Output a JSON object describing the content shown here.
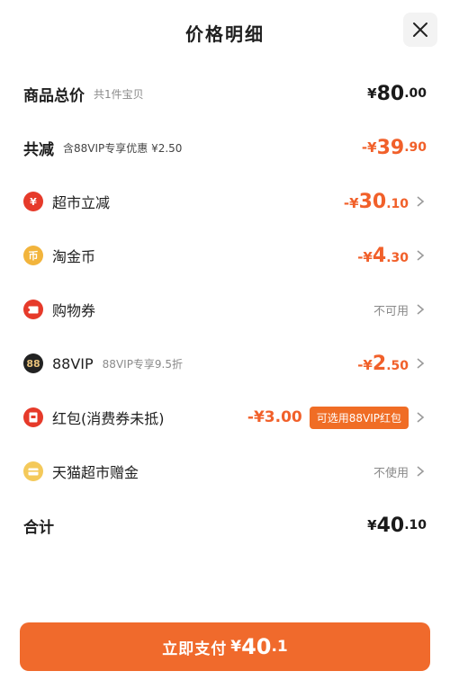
{
  "header": {
    "title": "价格明细",
    "close_icon": "close-icon"
  },
  "rows": {
    "total": {
      "label": "商品总价",
      "sub": "共1件宝贝",
      "currency": "¥",
      "int": "80",
      "dec": ".00"
    },
    "reduced": {
      "label": "共减",
      "sub": "含88VIP专享优惠 ¥2.50",
      "currency": "-¥",
      "int": "39",
      "dec": ".90"
    },
    "supermarket": {
      "label": "超市立减",
      "currency": "-¥",
      "int": "30",
      "dec": ".10",
      "icon": "yuan-badge-icon"
    },
    "taojinbi": {
      "label": "淘金币",
      "currency": "-¥",
      "int": "4",
      "dec": ".30",
      "icon": "coin-icon",
      "icon_text": "币"
    },
    "coupon": {
      "label": "购物券",
      "status": "不可用",
      "icon": "ticket-icon"
    },
    "vip": {
      "label": "88VIP",
      "sub": "88VIP专享9.5折",
      "currency": "-¥",
      "int": "2",
      "dec": ".50",
      "icon": "88-badge-icon",
      "icon_text": "88"
    },
    "redpacket": {
      "label": "红包(消费券未抵)",
      "amount": "-¥3.00",
      "pill": "可选用88VIP红包",
      "icon": "red-packet-icon"
    },
    "tmall_gift": {
      "label": "天猫超市赠金",
      "status": "不使用",
      "icon": "gift-card-icon"
    },
    "sum": {
      "label": "合计",
      "currency": "¥",
      "int": "40",
      "dec": ".10"
    }
  },
  "pay_button": {
    "label": "立即支付",
    "currency": "¥",
    "int": "40",
    "dec": ".1"
  },
  "colors": {
    "accent": "#f06a2c",
    "price_orange": "#f1602a",
    "muted": "#8a8a8a"
  }
}
